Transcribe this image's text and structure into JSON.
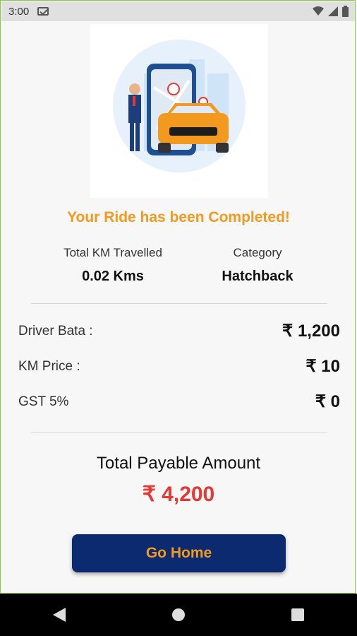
{
  "status_bar": {
    "time": "3:00"
  },
  "ride": {
    "title": "Your Ride has been Completed!",
    "km_label": "Total KM Travelled",
    "km_value": "0.02 Kms",
    "category_label": "Category",
    "category_value": "Hatchback"
  },
  "charges": [
    {
      "label": "Driver Bata :",
      "value": "₹ 1,200"
    },
    {
      "label": "KM Price :",
      "value": "₹ 10"
    },
    {
      "label": "GST 5%",
      "value": "₹ 0"
    }
  ],
  "total": {
    "label": "Total Payable Amount",
    "value": "₹ 4,200"
  },
  "go_home_label": "Go Home",
  "colors": {
    "accent": "#f29a1f",
    "button_bg": "#0b2a6f",
    "total_red": "#e53935"
  },
  "icons": [
    "mail-icon",
    "wifi-icon",
    "signal-icon",
    "battery-icon",
    "back-icon",
    "home-icon",
    "recents-icon"
  ]
}
